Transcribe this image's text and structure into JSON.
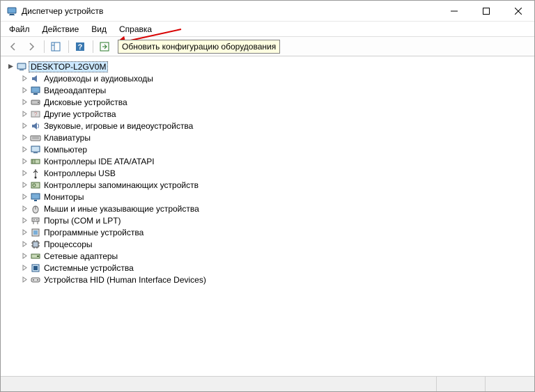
{
  "window": {
    "title": "Диспетчер устройств"
  },
  "menu": {
    "file": "Файл",
    "action": "Действие",
    "view": "Вид",
    "help": "Справка"
  },
  "tooltip": "Обновить конфигурацию оборудования",
  "tree": {
    "root": "DESKTOP-L2GV0M",
    "items": [
      "Аудиовходы и аудиовыходы",
      "Видеоадаптеры",
      "Дисковые устройства",
      "Другие устройства",
      "Звуковые, игровые и видеоустройства",
      "Клавиатуры",
      "Компьютер",
      "Контроллеры IDE ATA/ATAPI",
      "Контроллеры USB",
      "Контроллеры запоминающих устройств",
      "Мониторы",
      "Мыши и иные указывающие устройства",
      "Порты (COM и LPT)",
      "Программные устройства",
      "Процессоры",
      "Сетевые адаптеры",
      "Системные устройства",
      "Устройства HID (Human Interface Devices)"
    ]
  },
  "icons": [
    "audio-io-icon",
    "display-adapter-icon",
    "disk-drive-icon",
    "other-devices-icon",
    "sound-game-video-icon",
    "keyboard-icon",
    "computer-icon",
    "ide-controller-icon",
    "usb-controller-icon",
    "storage-controller-icon",
    "monitor-icon",
    "mouse-icon",
    "ports-icon",
    "software-device-icon",
    "processor-icon",
    "network-adapter-icon",
    "system-device-icon",
    "hid-icon"
  ]
}
